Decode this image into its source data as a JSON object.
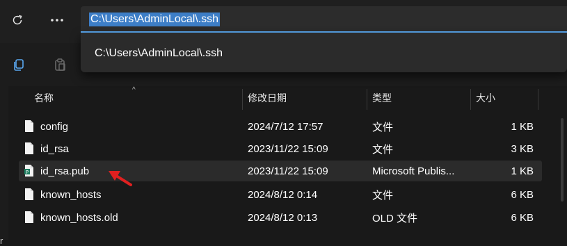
{
  "address_bar": {
    "path": "C:\\Users\\AdminLocal\\.ssh"
  },
  "dropdown": {
    "suggestion": "C:\\Users\\AdminLocal\\.ssh"
  },
  "toolbar": {
    "refresh_icon": "refresh-icon",
    "more_icon": "more-horizontal-icon",
    "copy_icon": "copy-icon",
    "paste_icon": "paste-icon"
  },
  "columns": {
    "name": "名称",
    "modified": "修改日期",
    "type": "类型",
    "size": "大小"
  },
  "files": [
    {
      "name": "config",
      "modified": "2024/7/12 17:57",
      "type": "文件",
      "size": "1 KB",
      "icon": "file-icon"
    },
    {
      "name": "id_rsa",
      "modified": "2023/11/22 15:09",
      "type": "文件",
      "size": "3 KB",
      "icon": "file-icon"
    },
    {
      "name": "id_rsa.pub",
      "modified": "2023/11/22 15:09",
      "type": "Microsoft Publis...",
      "size": "1 KB",
      "icon": "publisher-file-icon",
      "selected": true
    },
    {
      "name": "known_hosts",
      "modified": "2024/8/12 0:14",
      "type": "文件",
      "size": "6 KB",
      "icon": "file-icon"
    },
    {
      "name": "known_hosts.old",
      "modified": "2024/8/12 0:13",
      "type": "OLD 文件",
      "size": "6 KB",
      "icon": "file-icon"
    }
  ],
  "colors": {
    "background": "#191919",
    "selection_highlight": "#3d7ec7",
    "address_underline": "#5aa8f0",
    "annotation_arrow": "#e02020",
    "publisher_green": "#1d7c5f"
  },
  "left_edge_mark": "r"
}
